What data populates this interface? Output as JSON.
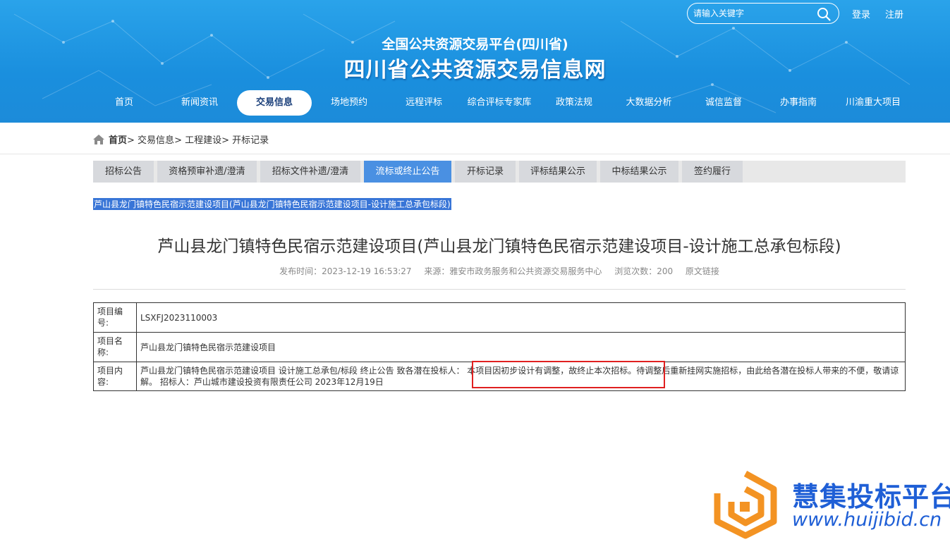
{
  "header": {
    "search_placeholder": "请输入关键字",
    "login": "登录",
    "register": "注册",
    "subtitle": "全国公共资源交易平台(四川省)",
    "title": "四川省公共资源交易信息网"
  },
  "nav": {
    "items": [
      {
        "label": "首页"
      },
      {
        "label": "新闻资讯"
      },
      {
        "label": "交易信息"
      },
      {
        "label": "场地预约"
      },
      {
        "label": "远程评标"
      },
      {
        "label": "综合评标专家库"
      },
      {
        "label": "政策法规"
      },
      {
        "label": "大数据分析"
      },
      {
        "label": "诚信监督"
      },
      {
        "label": "办事指南"
      },
      {
        "label": "川渝重大项目"
      }
    ],
    "active": "交易信息"
  },
  "breadcrumb": {
    "home": "首页",
    "items": [
      "交易信息",
      "工程建设",
      "开标记录"
    ]
  },
  "tabs": {
    "items": [
      {
        "label": "招标公告"
      },
      {
        "label": "资格预审补遗/澄清"
      },
      {
        "label": "招标文件补遗/澄清"
      },
      {
        "label": "流标或终止公告"
      },
      {
        "label": "开标记录"
      },
      {
        "label": "评标结果公示"
      },
      {
        "label": "中标结果公示"
      },
      {
        "label": "签约履行"
      }
    ],
    "active": "流标或终止公告"
  },
  "selected_title": "芦山县龙门镇特色民宿示范建设项目(芦山县龙门镇特色民宿示范建设项目-设计施工总承包标段)",
  "article": {
    "title": "芦山县龙门镇特色民宿示范建设项目(芦山县龙门镇特色民宿示范建设项目-设计施工总承包标段)",
    "publish_time": "发布时间：2023-12-19 16:53:27",
    "source": "来源：雅安市政务服务和公共资源交易服务中心",
    "views": "浏览次数：200",
    "original_link": "原文链接"
  },
  "table": {
    "rows": [
      {
        "label": "项目编号:",
        "value": "LSXFJ2023110003"
      },
      {
        "label": "项目名称:",
        "value": "芦山县龙门镇特色民宿示范建设项目"
      },
      {
        "label": "项目内容:",
        "value": "芦山县龙门镇特色民宿示范建设项目 设计施工总承包/标段 终止公告 致各潜在投标人： 本项目因初步设计有调整，故终止本次招标。待调整后重新挂网实施招标，由此给各潜在投标人带来的不便，敬请谅解。 招标人：芦山城市建设投资有限责任公司 2023年12月19日"
      }
    ]
  },
  "watermark": {
    "title": "慧集投标平台",
    "url": "www.huijibid.cn"
  },
  "colors": {
    "header_blue": "#1a8fde",
    "active_tab": "#4a90e2",
    "highlight_box": "#e02020",
    "watermark_orange": "#f39323",
    "watermark_blue": "#1f5fd6"
  }
}
